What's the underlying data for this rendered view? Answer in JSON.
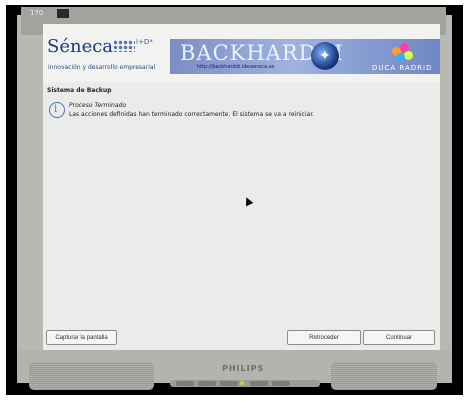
{
  "monitor": {
    "model_label": "170",
    "brand": "PHILIPS"
  },
  "header": {
    "seneca_logo_text": "Séneca",
    "seneca_sup": "I+D*",
    "seneca_tagline": "innovación y desarrollo empresarial",
    "banner_title": "BACKHARDDI",
    "banner_url": "http://backharddi.ideseneca.es",
    "duca_text": "DUCA RADRID"
  },
  "content": {
    "section_title": "Sistema de Backup",
    "message_title": "Proceso Terminado",
    "message_body": "Las acciones definidas han terminado correctamente. El sistema se va a reiniciar."
  },
  "buttons": {
    "capture": "Capturar la pantalla",
    "back": "Retroceder",
    "continue": "Continuar"
  },
  "colors": {
    "accent": "#4f6fb8",
    "banner": "#8ea3d8"
  }
}
